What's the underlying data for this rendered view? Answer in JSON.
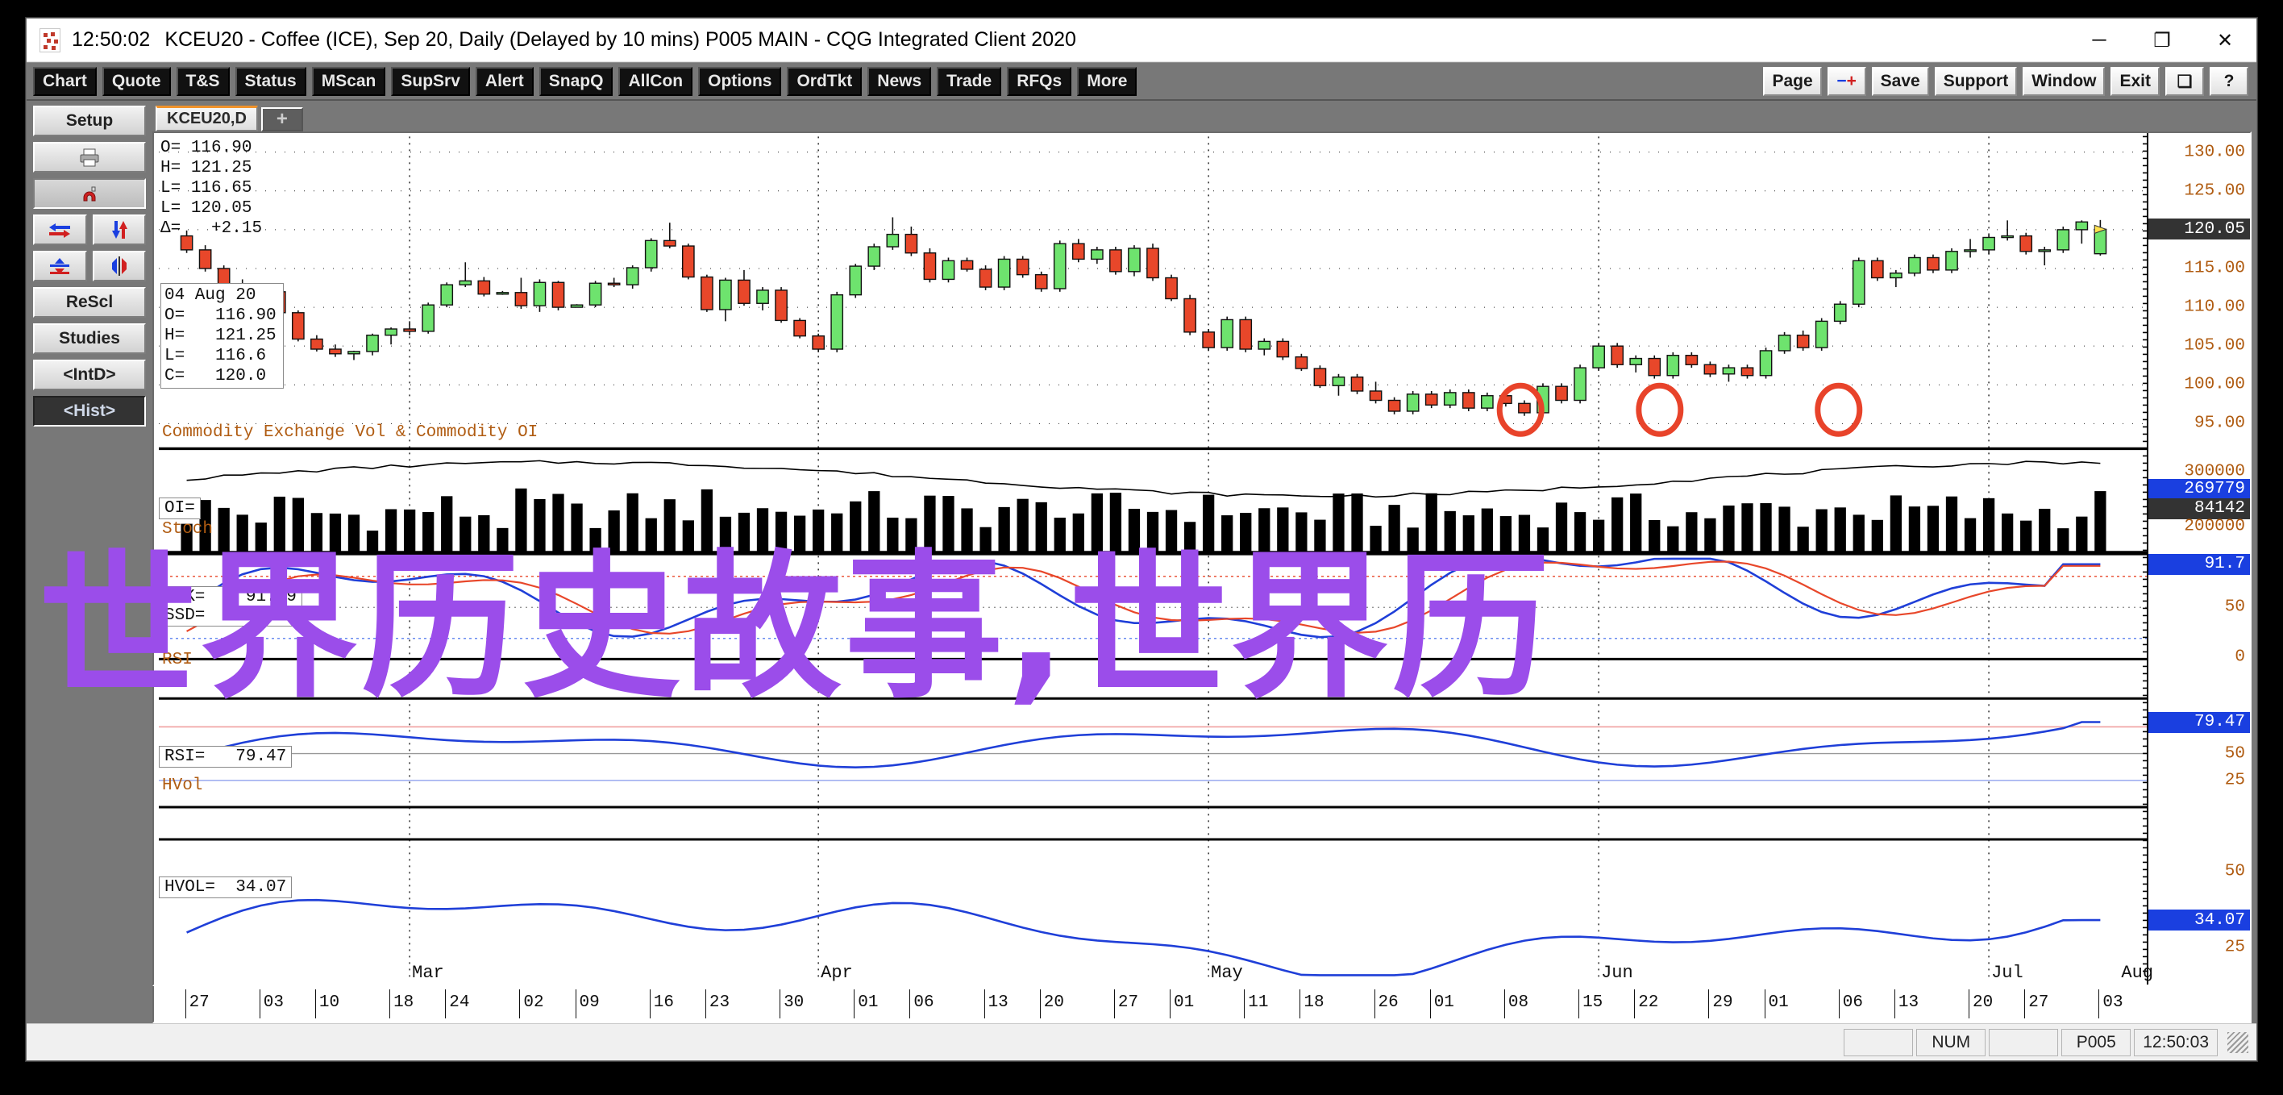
{
  "window": {
    "clock": "12:50:02",
    "title": "KCEU20 - Coffee (ICE), Sep 20, Daily (Delayed by 10 mins)   P005 MAIN - CQG Integrated Client 2020",
    "minimize": "─",
    "maximize": "❐",
    "close": "✕"
  },
  "toolbar": {
    "left": [
      "Chart",
      "Quote",
      "T&S",
      "Status",
      "MScan",
      "SupSrv",
      "Alert",
      "SnapQ",
      "AllCon",
      "Options",
      "OrdTkt",
      "News",
      "Trade",
      "RFQs",
      "More"
    ],
    "right": [
      "Page",
      "-+",
      "Save",
      "Support",
      "Window",
      "Exit",
      "❏",
      "?"
    ]
  },
  "rail": {
    "setup": "Setup",
    "print_icon": "print-icon",
    "magnet_icon": "magnet-icon",
    "tool1_icon": "horizontal-arrows-icon",
    "tool2_icon": "vertical-arrows-icon",
    "tool3_icon": "compress-icon",
    "tool4_icon": "expand-icon",
    "rescale": "ReScl",
    "studies": "Studies",
    "intraday": "<IntD>",
    "historical": "<Hist>"
  },
  "tabs": {
    "active": "KCEU20,D",
    "add": "+"
  },
  "quote": {
    "open_label": "O=",
    "open": "116.90",
    "high_label": "H=",
    "high": "121.25",
    "low_label": "L=",
    "low": "116.65",
    "last_label": "L=",
    "last": "120.05",
    "delta_label": "Δ=",
    "delta": "+2.15"
  },
  "tooltip": {
    "date": "04 Aug 20",
    "rows": [
      {
        "k": "O=",
        "v": "116.90"
      },
      {
        "k": "H=",
        "v": "121.25"
      },
      {
        "k": "L=",
        "v": "116.6"
      },
      {
        "k": "C=",
        "v": "120.0"
      }
    ]
  },
  "panes": {
    "volume_label": "Commodity Exchange Vol & Commodity OI",
    "oi_label": "OI=",
    "stoch_label": "Stoch",
    "ssk_label": "SSK=",
    "ssk_value": "91.69",
    "ssd_label": "SSD=",
    "ssd_value": "90.12",
    "rsi_label": "RSI",
    "rsi_eq_label": "RSI=",
    "rsi_value": "79.47",
    "hvol_label": "HVol",
    "hvol_eq_label": "HVOL=",
    "hvol_value": "34.07"
  },
  "statusbar": {
    "num": "NUM",
    "page": "P005",
    "time": "12:50:03"
  },
  "overlay_text": "世界历史故事,世界历",
  "colors": {
    "up": "#6ee36e",
    "down": "#e8472a",
    "accent": "#f0932b",
    "highlight": "#1a3fe0",
    "line_blue": "#1f3fd8",
    "line_red": "#e8472a",
    "annotation": "#e8432a"
  },
  "chart_data": {
    "type": "candlestick",
    "title": "KCEU20 - Coffee (ICE), Sep 20, Daily",
    "xlabel": "",
    "ylabel": "Price",
    "ylim": [
      92,
      132
    ],
    "grid": true,
    "y_ticks": [
      "130.00",
      "125.00",
      "120.05",
      "115.00",
      "110.00",
      "105.00",
      "100.00",
      "95.00"
    ],
    "last_price_marker": "120.05",
    "month_labels": [
      "Mar",
      "Apr",
      "May",
      "Jun",
      "Jul",
      "Aug"
    ],
    "day_ticks": [
      "27",
      "03",
      "10",
      "18",
      "24",
      "02",
      "09",
      "16",
      "23",
      "30",
      "01",
      "06",
      "13",
      "20",
      "27",
      "01",
      "11",
      "18",
      "26",
      "01",
      "08",
      "15",
      "22",
      "29",
      "01",
      "06",
      "13",
      "20",
      "27",
      "03"
    ],
    "ohlc": [
      [
        119.2,
        119.9,
        117.0,
        117.4
      ],
      [
        117.4,
        118.0,
        114.6,
        115.0
      ],
      [
        115.0,
        115.4,
        112.3,
        112.6
      ],
      [
        112.6,
        113.6,
        111.4,
        111.6
      ],
      [
        111.6,
        112.2,
        110.2,
        112.0
      ],
      [
        112.0,
        112.4,
        109.0,
        109.3
      ],
      [
        109.3,
        109.6,
        105.6,
        105.9
      ],
      [
        105.9,
        106.4,
        104.3,
        104.6
      ],
      [
        104.6,
        105.2,
        103.6,
        104.0
      ],
      [
        104.0,
        104.4,
        103.2,
        104.3
      ],
      [
        104.3,
        106.6,
        103.8,
        106.4
      ],
      [
        106.4,
        107.4,
        105.2,
        107.2
      ],
      [
        107.2,
        108.2,
        106.4,
        106.9
      ],
      [
        106.9,
        110.6,
        106.6,
        110.3
      ],
      [
        110.3,
        113.2,
        110.0,
        112.9
      ],
      [
        112.9,
        115.8,
        112.6,
        113.4
      ],
      [
        113.4,
        113.9,
        111.4,
        111.7
      ],
      [
        111.7,
        112.1,
        111.6,
        111.9
      ],
      [
        111.9,
        113.8,
        109.8,
        110.2
      ],
      [
        110.2,
        113.6,
        109.4,
        113.2
      ],
      [
        113.2,
        113.4,
        109.6,
        110.0
      ],
      [
        110.0,
        110.4,
        110.0,
        110.3
      ],
      [
        110.3,
        113.4,
        110.0,
        113.1
      ],
      [
        113.1,
        113.8,
        112.6,
        112.9
      ],
      [
        112.9,
        115.4,
        112.4,
        115.1
      ],
      [
        115.1,
        118.9,
        114.6,
        118.6
      ],
      [
        118.6,
        120.9,
        117.6,
        117.9
      ],
      [
        117.9,
        118.2,
        113.6,
        113.9
      ],
      [
        113.9,
        114.2,
        109.4,
        109.7
      ],
      [
        109.7,
        113.8,
        108.2,
        113.5
      ],
      [
        113.5,
        114.8,
        110.2,
        110.5
      ],
      [
        110.5,
        112.6,
        109.6,
        112.2
      ],
      [
        112.2,
        112.6,
        108.0,
        108.3
      ],
      [
        108.3,
        108.6,
        106.0,
        106.3
      ],
      [
        106.3,
        106.6,
        104.2,
        104.6
      ],
      [
        104.6,
        112.0,
        104.2,
        111.6
      ],
      [
        111.6,
        115.6,
        111.2,
        115.3
      ],
      [
        115.3,
        118.2,
        114.8,
        117.8
      ],
      [
        117.8,
        121.6,
        117.4,
        119.4
      ],
      [
        119.4,
        120.4,
        116.6,
        117.0
      ],
      [
        117.0,
        117.6,
        113.2,
        113.6
      ],
      [
        113.6,
        116.4,
        113.2,
        116.0
      ],
      [
        116.0,
        116.4,
        114.6,
        114.9
      ],
      [
        114.9,
        115.4,
        112.2,
        112.6
      ],
      [
        112.6,
        116.6,
        112.2,
        116.2
      ],
      [
        116.2,
        116.6,
        113.8,
        114.2
      ],
      [
        114.2,
        114.6,
        112.0,
        112.4
      ],
      [
        112.4,
        118.6,
        112.0,
        118.2
      ],
      [
        118.2,
        118.8,
        115.8,
        116.2
      ],
      [
        116.2,
        117.8,
        115.6,
        117.4
      ],
      [
        117.4,
        117.8,
        114.2,
        114.6
      ],
      [
        114.6,
        118.0,
        114.0,
        117.6
      ],
      [
        117.6,
        118.2,
        113.4,
        113.8
      ],
      [
        113.8,
        114.2,
        110.8,
        111.1
      ],
      [
        111.1,
        111.6,
        106.4,
        106.8
      ],
      [
        106.8,
        107.2,
        104.4,
        104.8
      ],
      [
        104.8,
        108.8,
        104.4,
        108.4
      ],
      [
        108.4,
        108.8,
        104.2,
        104.6
      ],
      [
        104.6,
        106.0,
        103.8,
        105.6
      ],
      [
        105.6,
        106.0,
        103.2,
        103.6
      ],
      [
        103.6,
        104.0,
        101.8,
        102.1
      ],
      [
        102.1,
        102.5,
        99.6,
        99.9
      ],
      [
        99.9,
        101.4,
        98.6,
        101.0
      ],
      [
        101.0,
        101.4,
        98.8,
        99.2
      ],
      [
        99.2,
        100.4,
        97.6,
        98.0
      ],
      [
        98.0,
        98.4,
        96.2,
        96.6
      ],
      [
        96.6,
        99.2,
        96.2,
        98.8
      ],
      [
        98.8,
        99.2,
        97.0,
        97.4
      ],
      [
        97.4,
        99.4,
        97.0,
        99.0
      ],
      [
        99.0,
        99.4,
        96.6,
        97.0
      ],
      [
        97.0,
        99.0,
        96.6,
        98.6
      ],
      [
        98.6,
        99.0,
        97.2,
        97.6
      ],
      [
        97.6,
        98.0,
        96.0,
        96.4
      ],
      [
        96.4,
        100.2,
        96.0,
        99.8
      ],
      [
        99.8,
        100.2,
        97.6,
        98.0
      ],
      [
        98.0,
        102.6,
        97.6,
        102.2
      ],
      [
        102.2,
        105.4,
        101.8,
        105.0
      ],
      [
        105.0,
        105.4,
        102.2,
        102.6
      ],
      [
        102.6,
        103.8,
        101.6,
        103.4
      ],
      [
        103.4,
        103.8,
        100.8,
        101.2
      ],
      [
        101.2,
        104.2,
        100.8,
        103.8
      ],
      [
        103.8,
        104.2,
        102.2,
        102.6
      ],
      [
        102.6,
        103.0,
        101.0,
        101.4
      ],
      [
        101.4,
        102.6,
        100.4,
        102.2
      ],
      [
        102.2,
        102.6,
        100.8,
        101.2
      ],
      [
        101.2,
        104.8,
        100.8,
        104.4
      ],
      [
        104.4,
        106.8,
        104.0,
        106.4
      ],
      [
        106.4,
        107.0,
        104.4,
        104.8
      ],
      [
        104.8,
        108.6,
        104.4,
        108.2
      ],
      [
        108.2,
        110.8,
        107.8,
        110.4
      ],
      [
        110.4,
        116.4,
        110.0,
        116.0
      ],
      [
        116.0,
        116.4,
        113.4,
        113.8
      ],
      [
        113.8,
        114.8,
        112.6,
        114.4
      ],
      [
        114.4,
        116.8,
        114.0,
        116.4
      ],
      [
        116.4,
        116.8,
        114.4,
        114.8
      ],
      [
        114.8,
        117.6,
        114.4,
        117.2
      ],
      [
        117.2,
        118.8,
        116.4,
        117.4
      ],
      [
        117.4,
        119.4,
        116.8,
        119.0
      ],
      [
        119.0,
        121.2,
        118.6,
        119.2
      ],
      [
        119.2,
        119.6,
        116.8,
        117.2
      ],
      [
        117.2,
        117.8,
        115.4,
        117.4
      ],
      [
        117.4,
        120.4,
        117.0,
        120.0
      ],
      [
        120.0,
        121.2,
        118.2,
        121.0
      ],
      [
        116.9,
        121.25,
        116.65,
        120.05
      ]
    ]
  }
}
